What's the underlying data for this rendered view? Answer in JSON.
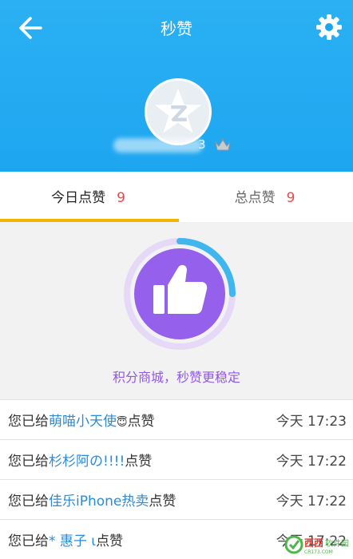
{
  "header": {
    "title": "秒赞",
    "username_visible_tail": "3"
  },
  "tabs": [
    {
      "label": "今日点赞",
      "count": "9"
    },
    {
      "label": "总点赞",
      "count": "9"
    }
  ],
  "promo_text": "积分商城，秒赞更稳定",
  "likes": [
    {
      "prefix": "您已给",
      "name": "萌喵小天使",
      "emoji": "😇",
      "suffix": "点赞",
      "time": "今天 17:23"
    },
    {
      "prefix": "您已给",
      "name": "杉杉阿の!!!!",
      "emoji": "",
      "suffix": "点赞",
      "time": "今天 17:22"
    },
    {
      "prefix": "您已给",
      "name": "佳乐iPhone热卖",
      "emoji": "",
      "suffix": "点赞",
      "time": "今天 17:22"
    },
    {
      "prefix": "您已给",
      "name": "* 惠子 ι",
      "emoji": "",
      "suffix": "点赞",
      "time": "今天 17:22"
    }
  ],
  "watermark": {
    "brand": "西西",
    "label": "软件园",
    "site": "CR173.COM"
  },
  "colors": {
    "header_blue": "#1da6f0",
    "tab_underline": "#f4b400",
    "count_red": "#f04747",
    "name_blue": "#2a8bd9",
    "promo_purple": "#9159ea"
  }
}
